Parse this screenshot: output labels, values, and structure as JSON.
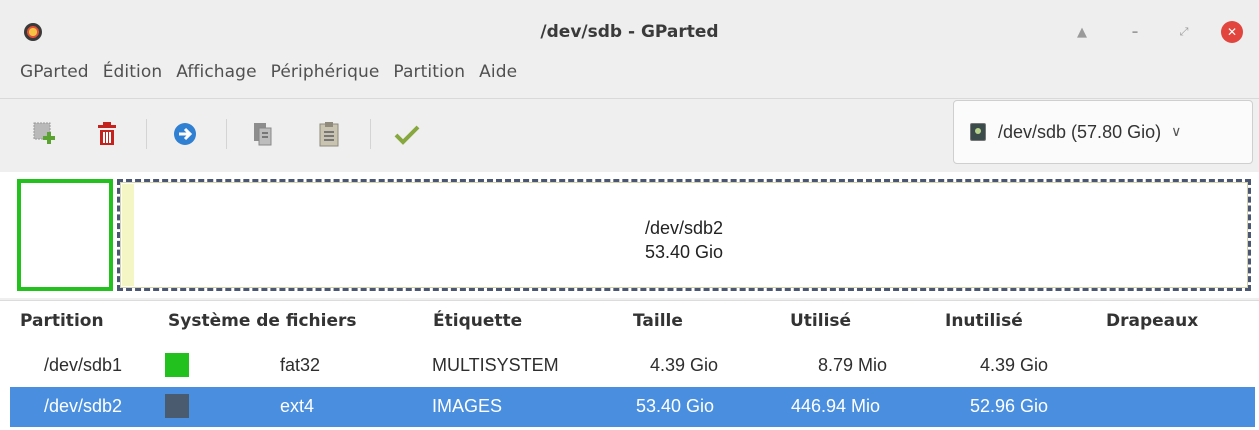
{
  "window": {
    "title": "/dev/sdb - GParted"
  },
  "menu": [
    "GParted",
    "Édition",
    "Affichage",
    "Périphérique",
    "Partition",
    "Aide"
  ],
  "device_selector": {
    "label": "/dev/sdb  (57.80 Gio)"
  },
  "partition_map": {
    "selected": {
      "name": "/dev/sdb2",
      "size": "53.40 Gio"
    }
  },
  "table": {
    "headers": [
      "Partition",
      "Système de fichiers",
      "Étiquette",
      "Taille",
      "Utilisé",
      "Inutilisé",
      "Drapeaux"
    ],
    "rows": [
      {
        "partition": "/dev/sdb1",
        "fs_color": "#22c11e",
        "filesystem": "fat32",
        "label": "MULTISYSTEM",
        "size": "4.39 Gio",
        "used": "8.79 Mio",
        "unused": "4.39 Gio",
        "flags": ""
      },
      {
        "partition": "/dev/sdb2",
        "fs_color": "#4a5b70",
        "filesystem": "ext4",
        "label": "IMAGES",
        "size": "53.40 Gio",
        "used": "446.94 Mio",
        "unused": "52.96 Gio",
        "flags": ""
      }
    ]
  },
  "colors": {
    "selection": "#4a8fdf",
    "fat32": "#22c11e",
    "ext4": "#4a5b70"
  }
}
